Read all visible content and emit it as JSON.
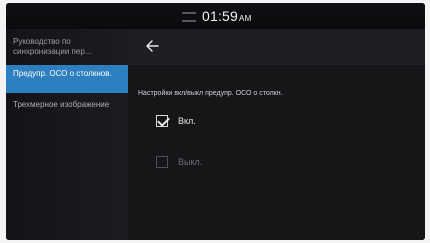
{
  "status": {
    "time": "01:59",
    "ampm": "AM"
  },
  "sidebar": {
    "items": [
      {
        "label": "Руководство по синхронизации пер..."
      },
      {
        "label": "Предупр. ОСО о столкнов."
      },
      {
        "label": "Трехмерное изображение"
      }
    ]
  },
  "main": {
    "heading": "Настройки вкл/выкл предупр. ОСО о столкн.",
    "options": [
      {
        "label": "Вкл.",
        "checked": true
      },
      {
        "label": "Выкл.",
        "checked": false
      }
    ]
  },
  "colors": {
    "accent": "#2e7fbf",
    "background": "#0b0b0d"
  }
}
